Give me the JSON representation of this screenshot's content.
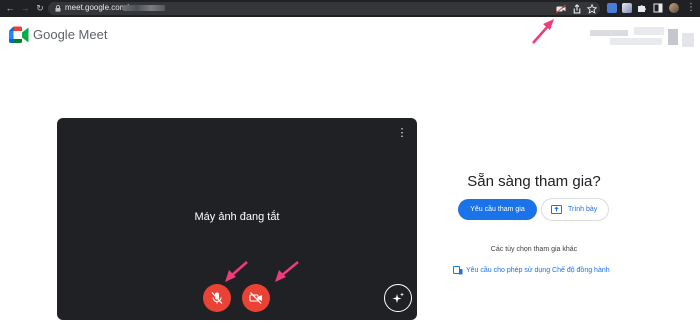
{
  "browser": {
    "url": "meet.google.com/",
    "nav": {
      "back_icon": "back-arrow-icon",
      "forward_icon": "forward-arrow-icon",
      "reload_icon": "reload-icon"
    },
    "omnibox_icons": [
      "camera-blocked-icon",
      "share-icon",
      "bookmark-star-icon"
    ],
    "extension_icons": [
      "extension-icon",
      "extension-icon",
      "puzzle-extensions-icon",
      "side-panel-icon",
      "profile-icon",
      "menu-icon"
    ]
  },
  "header": {
    "brand": "Google Meet",
    "logo_colors": [
      "#00832d",
      "#0066da",
      "#e94235",
      "#2684fc",
      "#00ac47",
      "#ffba00"
    ]
  },
  "preview": {
    "status_text": "Máy ảnh đang tắt",
    "more_options_glyph": "⋮",
    "mic_button": {
      "icon": "mic-off-icon",
      "state": "off"
    },
    "camera_button": {
      "icon": "camera-off-icon",
      "state": "off"
    },
    "effects_button": {
      "icon": "sparkle-effects-icon"
    }
  },
  "join": {
    "title": "Sẵn sàng tham gia?",
    "join_button": "Yêu cầu tham gia",
    "present_button": "Trình bày",
    "other_options": "Các tùy chọn tham gia khác",
    "companion_link": "Yêu cầu cho phép sử dụng Chế độ đồng hành"
  },
  "colors": {
    "toolbar": "#202124",
    "omnibox": "#35363a",
    "preview_bg": "#202124",
    "off_button": "#ea4335",
    "primary": "#1a73e8",
    "annotation_arrow": "#ef3b7a"
  }
}
